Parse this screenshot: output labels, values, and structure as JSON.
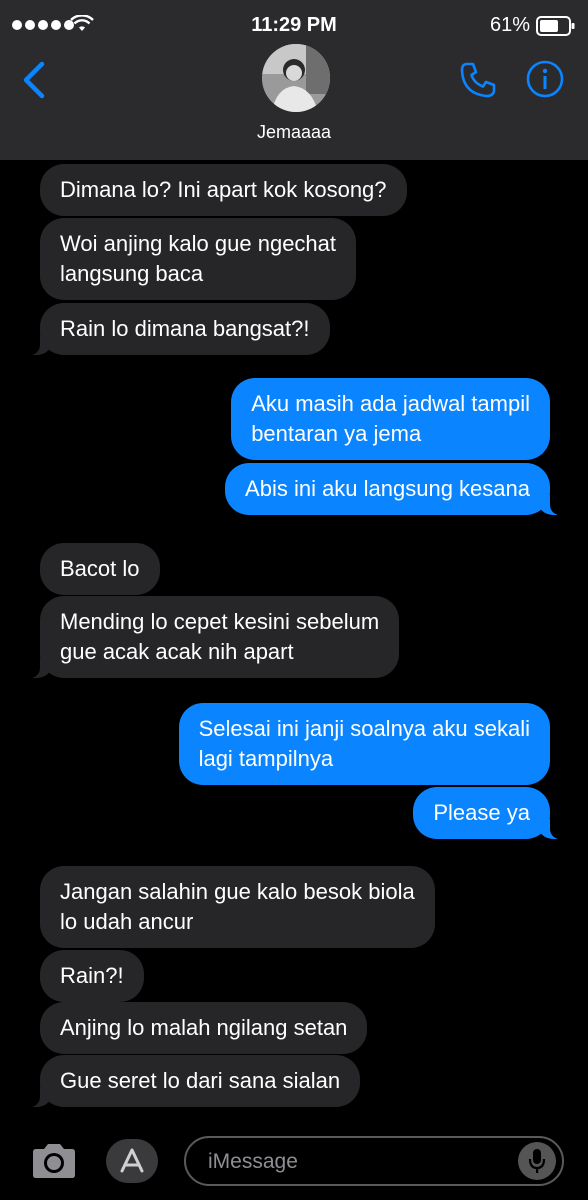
{
  "status_bar": {
    "time": "11:29 PM",
    "battery": "61%"
  },
  "header": {
    "contact_name": "Jemaaaa"
  },
  "messages": [
    {
      "dir": "in",
      "lines": [
        "Dimana lo? Ini apart kok kosong?"
      ]
    },
    {
      "dir": "in",
      "lines": [
        "Woi anjing kalo gue ngechat",
        "langsung baca"
      ]
    },
    {
      "dir": "in",
      "lines": [
        "Rain lo dimana bangsat?!"
      ]
    },
    {
      "dir": "out",
      "lines": [
        "Aku masih ada jadwal tampil",
        "bentaran ya jema"
      ]
    },
    {
      "dir": "out",
      "lines": [
        "Abis ini aku langsung kesana"
      ]
    },
    {
      "dir": "in",
      "lines": [
        "Bacot lo"
      ]
    },
    {
      "dir": "in",
      "lines": [
        "Mending lo cepet kesini sebelum",
        "gue acak acak nih apart"
      ]
    },
    {
      "dir": "out",
      "lines": [
        "Selesai ini janji soalnya aku sekali",
        "lagi tampilnya"
      ]
    },
    {
      "dir": "out",
      "lines": [
        "Please ya"
      ]
    },
    {
      "dir": "in",
      "lines": [
        "Jangan salahin gue kalo besok biola",
        "lo udah ancur"
      ]
    },
    {
      "dir": "in",
      "lines": [
        "Rain?!"
      ]
    },
    {
      "dir": "in",
      "lines": [
        "Anjing lo malah ngilang setan"
      ]
    },
    {
      "dir": "in",
      "lines": [
        "Gue seret lo dari sana sialan"
      ]
    }
  ],
  "composer": {
    "placeholder": "iMessage"
  },
  "icons": {
    "back": "chevron-left-icon",
    "phone": "phone-icon",
    "info": "info-icon",
    "camera": "camera-icon",
    "apps": "app-store-icon",
    "mic": "microphone-icon"
  },
  "colors": {
    "accent": "#0a84ff",
    "incoming_bubble": "#262628",
    "header_bg": "#2b2b2d"
  }
}
